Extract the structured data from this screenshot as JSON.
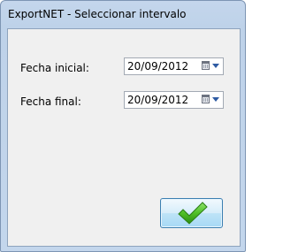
{
  "window": {
    "title": "ExportNET - Seleccionar intervalo"
  },
  "form": {
    "start_label": "Fecha inicial:",
    "start_value": "20/09/2012",
    "end_label": "Fecha final:",
    "end_value": "20/09/2012"
  },
  "ok_button": {
    "icon": "checkmark-icon",
    "color": "#35a51b"
  },
  "colors": {
    "titlebar": "#c4d6ec",
    "client": "#f0f0f0",
    "button_border": "#3c7fb1"
  }
}
